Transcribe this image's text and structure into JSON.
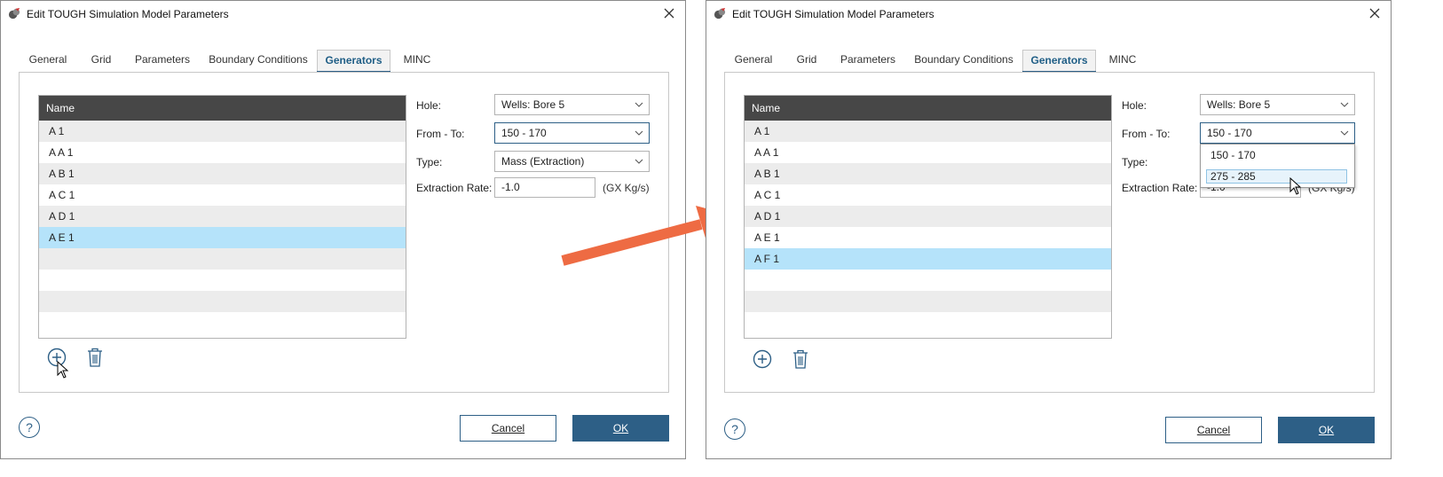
{
  "left": {
    "title": "Edit TOUGH Simulation Model Parameters",
    "tabs": [
      "General",
      "Grid",
      "Parameters",
      "Boundary Conditions",
      "Generators",
      "MINC"
    ],
    "active_tab": "Generators",
    "list": {
      "header": "Name",
      "items": [
        "A 1",
        "A A 1",
        "A B 1",
        "A C 1",
        "A D 1",
        "A E 1"
      ],
      "selected": "A E 1"
    },
    "fields": {
      "hole_label": "Hole:",
      "hole_value": "Wells: Bore 5",
      "fromto_label": "From - To:",
      "fromto_value": "150 - 170",
      "type_label": "Type:",
      "type_value": "Mass (Extraction)",
      "rate_label": "Extraction Rate:",
      "rate_value": "-1.0",
      "rate_unit": "(GX  Kg/s)"
    },
    "buttons": {
      "help": "?",
      "cancel": "Cancel",
      "ok": "OK"
    }
  },
  "right": {
    "title": "Edit TOUGH Simulation Model Parameters",
    "tabs": [
      "General",
      "Grid",
      "Parameters",
      "Boundary Conditions",
      "Generators",
      "MINC"
    ],
    "active_tab": "Generators",
    "list": {
      "header": "Name",
      "items": [
        "A 1",
        "A A 1",
        "A B 1",
        "A C 1",
        "A D 1",
        "A E 1",
        "A F 1"
      ],
      "selected": "A F 1"
    },
    "fields": {
      "hole_label": "Hole:",
      "hole_value": "Wells: Bore 5",
      "fromto_label": "From - To:",
      "fromto_value": "150 - 170",
      "type_label": "Type:",
      "rate_label": "Extraction Rate:",
      "rate_value": "-1.0",
      "rate_unit": "(GX  Kg/s)"
    },
    "dropdown_options": [
      "150 - 170",
      "275 - 285"
    ],
    "dropdown_hover": "275 - 285",
    "buttons": {
      "help": "?",
      "cancel": "Cancel",
      "ok": "OK"
    }
  },
  "colors": {
    "accent": "#2d5f86",
    "list_header": "#474747",
    "selected_row": "#b5e3fa",
    "alt_row": "#ececec",
    "arrow": "#ee6b43"
  }
}
